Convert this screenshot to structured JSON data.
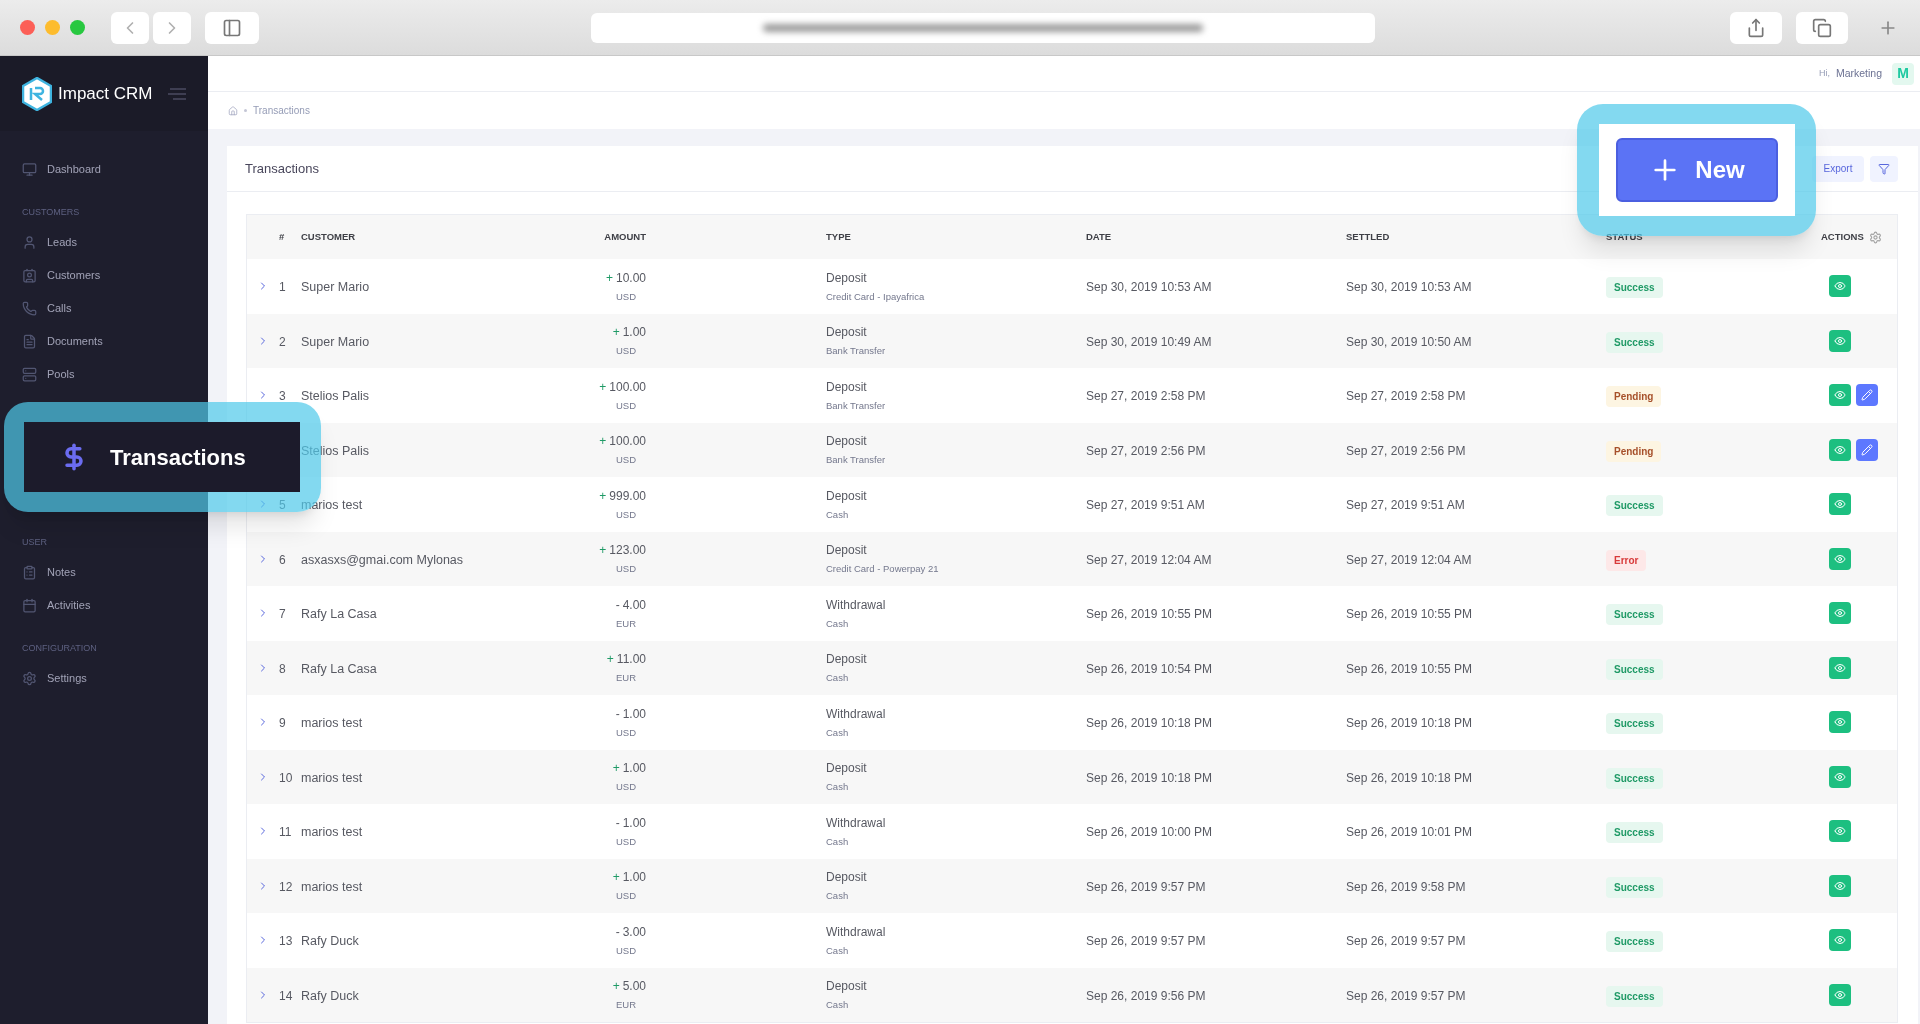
{
  "app": {
    "logo_text": "Impact CRM"
  },
  "sidebar": {
    "sections": [
      {
        "items": [
          {
            "label": "Dashboard"
          }
        ]
      },
      {
        "title": "CUSTOMERS",
        "items": [
          {
            "label": "Leads"
          },
          {
            "label": "Customers"
          },
          {
            "label": "Calls"
          },
          {
            "label": "Documents"
          },
          {
            "label": "Pools"
          }
        ]
      },
      {
        "title": "USER",
        "items": [
          {
            "label": "Notes"
          },
          {
            "label": "Activities"
          }
        ]
      },
      {
        "title": "CONFIGURATION",
        "items": [
          {
            "label": "Settings"
          }
        ]
      }
    ]
  },
  "topbar": {
    "greeting": "Hi,",
    "user": "Marketing",
    "avatar": "M"
  },
  "breadcrumb": [
    "Transactions"
  ],
  "card": {
    "title": "Transactions",
    "export": "Export"
  },
  "table": {
    "columns": [
      "#",
      "CUSTOMER",
      "AMOUNT",
      "TYPE",
      "DATE",
      "SETTLED",
      "STATUS",
      "ACTIONS"
    ],
    "rows": [
      {
        "kind": "credit",
        "num": "1",
        "customer": "Super Mario",
        "sign": "+",
        "amount": "10.00",
        "currency": "USD",
        "type": "Deposit",
        "method": "Credit Card - Ipayafrica",
        "date": "Sep 30, 2019 10:53 AM",
        "settled": "Sep 30, 2019 10:53 AM",
        "status": {
          "label": "Success",
          "kind": "success"
        },
        "actions": [
          {
            "kind": "view"
          }
        ]
      },
      {
        "kind": "credit",
        "num": "2",
        "customer": "Super Mario",
        "sign": "+",
        "amount": "1.00",
        "currency": "USD",
        "type": "Deposit",
        "method": "Bank Transfer",
        "date": "Sep 30, 2019 10:49 AM",
        "settled": "Sep 30, 2019 10:50 AM",
        "status": {
          "label": "Success",
          "kind": "success"
        },
        "actions": [
          {
            "kind": "view"
          }
        ]
      },
      {
        "kind": "credit",
        "num": "3",
        "customer": "Stelios Palis",
        "sign": "+",
        "amount": "100.00",
        "currency": "USD",
        "type": "Deposit",
        "method": "Bank Transfer",
        "date": "Sep 27, 2019 2:58 PM",
        "settled": "Sep 27, 2019 2:58 PM",
        "status": {
          "label": "Pending",
          "kind": "pending"
        },
        "actions": [
          {
            "kind": "view"
          },
          {
            "kind": "edit"
          }
        ]
      },
      {
        "kind": "credit",
        "customer": "Stelios Palis",
        "sign": "+",
        "amount": "100.00",
        "currency": "USD",
        "type": "Deposit",
        "method": "Bank Transfer",
        "date": "Sep 27, 2019 2:56 PM",
        "settled": "Sep 27, 2019 2:56 PM",
        "status": {
          "label": "Pending",
          "kind": "pending"
        },
        "actions": [
          {
            "kind": "view"
          },
          {
            "kind": "edit"
          }
        ]
      },
      {
        "kind": "credit",
        "num": "5",
        "customer": "marios test",
        "sign": "+",
        "amount": "999.00",
        "currency": "USD",
        "type": "Deposit",
        "method": "Cash",
        "date": "Sep 27, 2019 9:51 AM",
        "settled": "Sep 27, 2019 9:51 AM",
        "status": {
          "label": "Success",
          "kind": "success"
        },
        "actions": [
          {
            "kind": "view"
          }
        ]
      },
      {
        "kind": "credit",
        "num": "6",
        "customer": "asxasxs@gmai.com Mylonas",
        "sign": "+",
        "amount": "123.00",
        "currency": "USD",
        "type": "Deposit",
        "method": "Credit Card - Powerpay 21",
        "date": "Sep 27, 2019 12:04 AM",
        "settled": "Sep 27, 2019 12:04 AM",
        "status": {
          "label": "Error",
          "kind": "error"
        },
        "actions": [
          {
            "kind": "view"
          }
        ]
      },
      {
        "kind": "debit",
        "num": "7",
        "customer": "Rafy La Casa",
        "sign": "-",
        "amount": "4.00",
        "currency": "EUR",
        "type": "Withdrawal",
        "method": "Cash",
        "date": "Sep 26, 2019 10:55 PM",
        "settled": "Sep 26, 2019 10:55 PM",
        "status": {
          "label": "Success",
          "kind": "success"
        },
        "actions": [
          {
            "kind": "view"
          }
        ]
      },
      {
        "kind": "credit",
        "num": "8",
        "customer": "Rafy La Casa",
        "sign": "+",
        "amount": "11.00",
        "currency": "EUR",
        "type": "Deposit",
        "method": "Cash",
        "date": "Sep 26, 2019 10:54 PM",
        "settled": "Sep 26, 2019 10:55 PM",
        "status": {
          "label": "Success",
          "kind": "success"
        },
        "actions": [
          {
            "kind": "view"
          }
        ]
      },
      {
        "kind": "debit",
        "num": "9",
        "customer": "marios test",
        "sign": "-",
        "amount": "1.00",
        "currency": "USD",
        "type": "Withdrawal",
        "method": "Cash",
        "date": "Sep 26, 2019 10:18 PM",
        "settled": "Sep 26, 2019 10:18 PM",
        "status": {
          "label": "Success",
          "kind": "success"
        },
        "actions": [
          {
            "kind": "view"
          }
        ]
      },
      {
        "kind": "credit",
        "num": "10",
        "customer": "marios test",
        "sign": "+",
        "amount": "1.00",
        "currency": "USD",
        "type": "Deposit",
        "method": "Cash",
        "date": "Sep 26, 2019 10:18 PM",
        "settled": "Sep 26, 2019 10:18 PM",
        "status": {
          "label": "Success",
          "kind": "success"
        },
        "actions": [
          {
            "kind": "view"
          }
        ]
      },
      {
        "kind": "debit",
        "num": "11",
        "customer": "marios test",
        "sign": "-",
        "amount": "1.00",
        "currency": "USD",
        "type": "Withdrawal",
        "method": "Cash",
        "date": "Sep 26, 2019 10:00 PM",
        "settled": "Sep 26, 2019 10:01 PM",
        "status": {
          "label": "Success",
          "kind": "success"
        },
        "actions": [
          {
            "kind": "view"
          }
        ]
      },
      {
        "kind": "credit",
        "num": "12",
        "customer": "marios test",
        "sign": "+",
        "amount": "1.00",
        "currency": "USD",
        "type": "Deposit",
        "method": "Cash",
        "date": "Sep 26, 2019 9:57 PM",
        "settled": "Sep 26, 2019 9:58 PM",
        "status": {
          "label": "Success",
          "kind": "success"
        },
        "actions": [
          {
            "kind": "view"
          }
        ]
      },
      {
        "kind": "debit",
        "num": "13",
        "customer": "Rafy Duck",
        "sign": "-",
        "amount": "3.00",
        "currency": "USD",
        "type": "Withdrawal",
        "method": "Cash",
        "date": "Sep 26, 2019 9:57 PM",
        "settled": "Sep 26, 2019 9:57 PM",
        "status": {
          "label": "Success",
          "kind": "success"
        },
        "actions": [
          {
            "kind": "view"
          }
        ]
      },
      {
        "kind": "credit",
        "num": "14",
        "customer": "Rafy Duck",
        "sign": "+",
        "amount": "5.00",
        "currency": "EUR",
        "type": "Deposit",
        "method": "Cash",
        "date": "Sep 26, 2019 9:56 PM",
        "settled": "Sep 26, 2019 9:57 PM",
        "status": {
          "label": "Success",
          "kind": "success"
        },
        "actions": [
          {
            "kind": "view"
          }
        ]
      }
    ]
  },
  "callouts": [
    {
      "kind": "sidebar_item",
      "label": "Transactions"
    },
    {
      "kind": "button",
      "label": "New"
    }
  ]
}
